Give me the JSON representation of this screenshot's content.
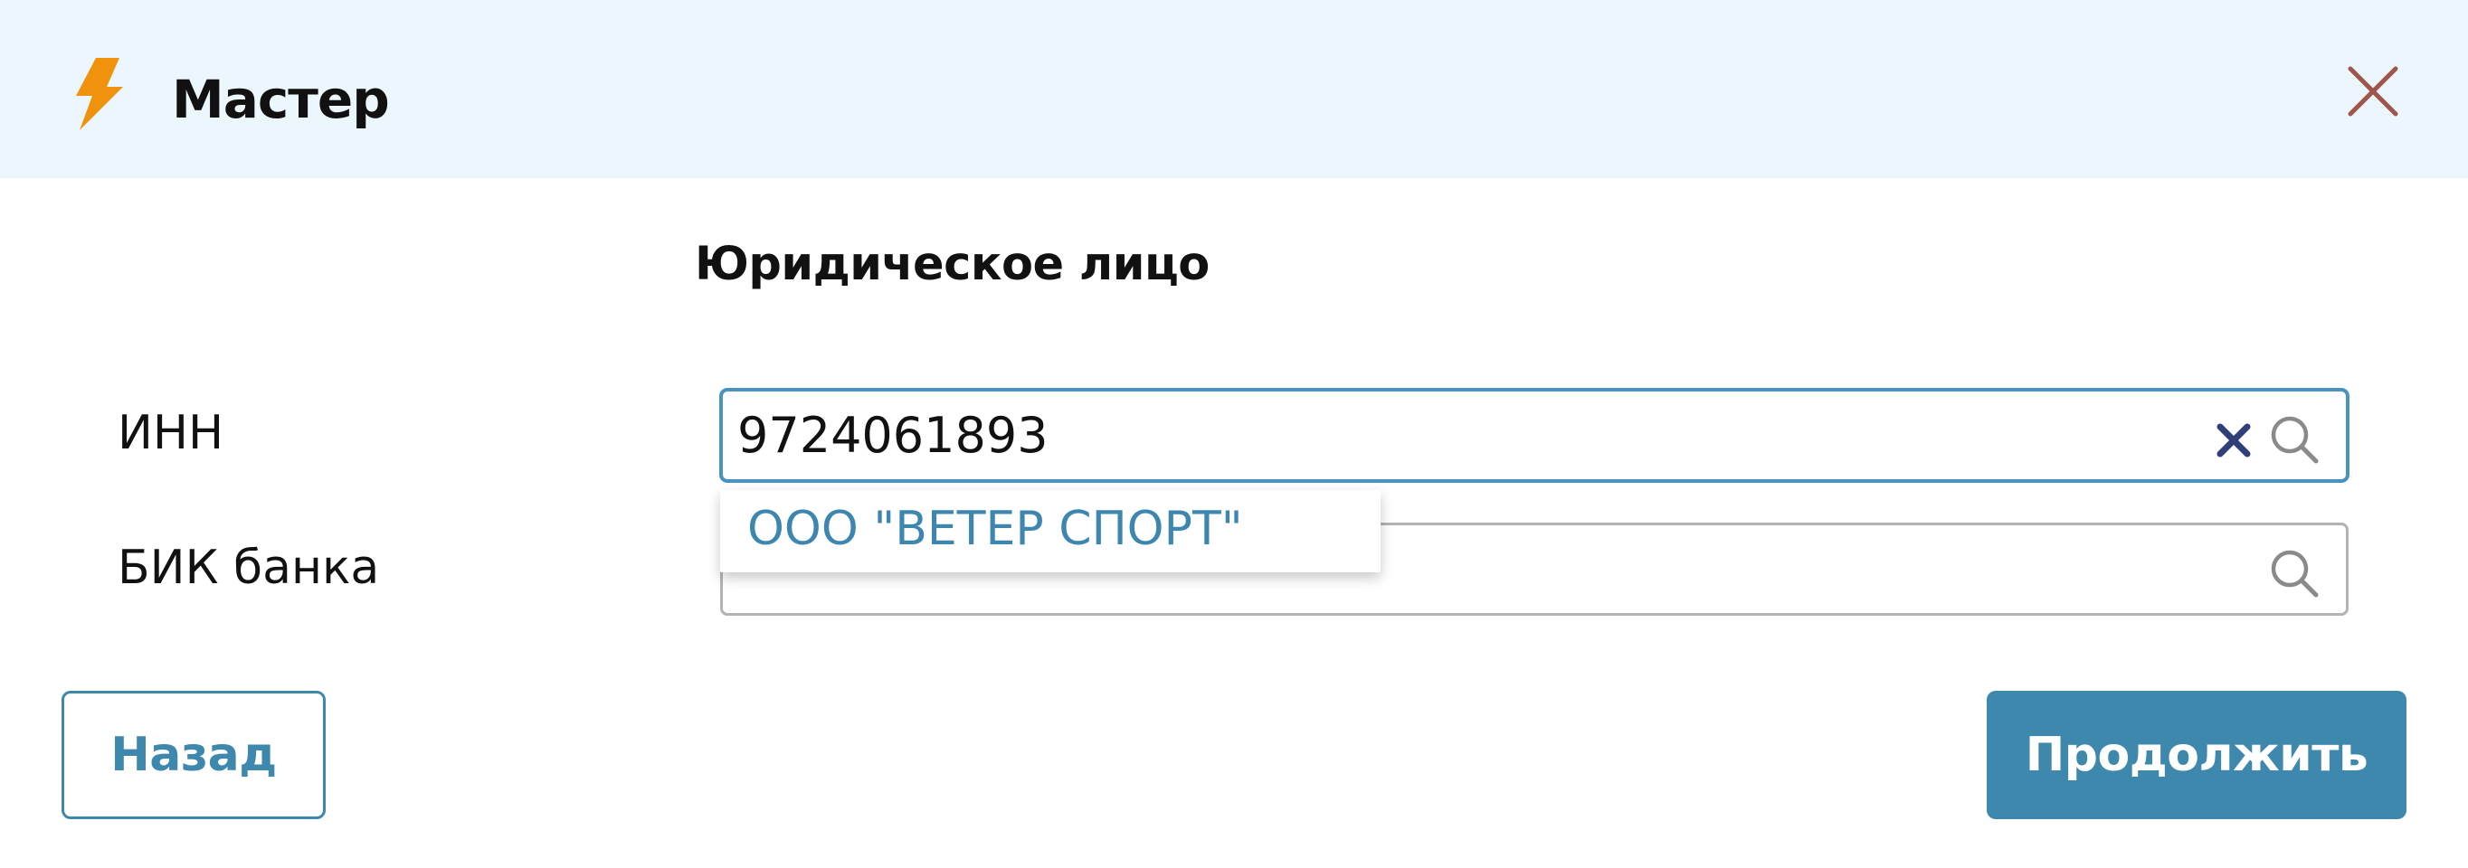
{
  "header": {
    "title": "Мастер"
  },
  "form": {
    "section_title": "Юридическое лицо",
    "inn": {
      "label": "ИНН",
      "value": "9724061893"
    },
    "bik": {
      "label": "БИК банка",
      "value": ""
    },
    "suggestions": [
      "ООО \"ВЕТЕР СПОРТ\""
    ]
  },
  "footer": {
    "back_label": "Назад",
    "continue_label": "Продолжить"
  },
  "icons": {
    "logo": "lightning-icon",
    "close": "close-icon",
    "search": "search-icon",
    "clear": "clear-icon"
  },
  "colors": {
    "header_bg": "#ebf6fd",
    "accent": "#3e87ad",
    "logo": "#f0920c",
    "close": "#a0564b",
    "clear": "#2f3f7a",
    "suggestion_text": "#3d86b0"
  }
}
